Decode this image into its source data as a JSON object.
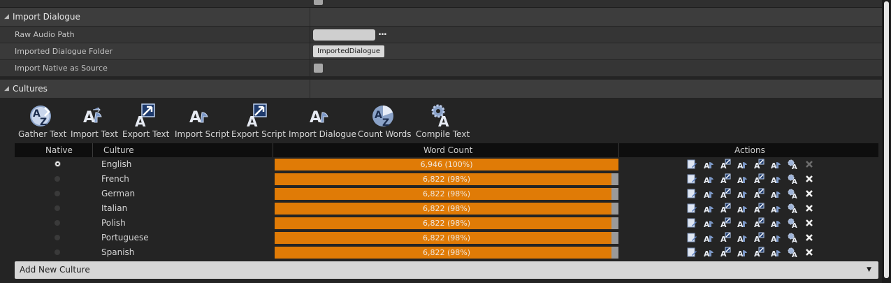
{
  "sections": {
    "import_dialogue": {
      "title": "Import Dialogue",
      "properties": [
        {
          "label": "Raw Audio Path",
          "value": "",
          "button": "..."
        },
        {
          "label": "Imported Dialogue Folder",
          "value": "ImportedDialogue"
        },
        {
          "label": "Import Native as Source",
          "checked": false
        }
      ]
    },
    "cultures": {
      "title": "Cultures"
    }
  },
  "toolbar": [
    {
      "label": "Gather Text",
      "icon": "gather-text-icon"
    },
    {
      "label": "Import Text",
      "icon": "import-text-icon"
    },
    {
      "label": "Export Text",
      "icon": "export-text-icon"
    },
    {
      "label": "Import Script",
      "icon": "import-script-icon"
    },
    {
      "label": "Export Script",
      "icon": "export-script-icon"
    },
    {
      "label": "Import Dialogue",
      "icon": "import-dialogue-icon"
    },
    {
      "label": "Count Words",
      "icon": "count-words-icon"
    },
    {
      "label": "Compile Text",
      "icon": "compile-text-icon"
    }
  ],
  "table": {
    "headers": {
      "native": "Native",
      "culture": "Culture",
      "word_count": "Word Count",
      "actions": "Actions"
    },
    "rows": [
      {
        "native": true,
        "culture": "English",
        "word_count": "6,946 (100%)",
        "percent": 100
      },
      {
        "native": false,
        "culture": "French",
        "word_count": "6,822 (98%)",
        "percent": 98
      },
      {
        "native": false,
        "culture": "German",
        "word_count": "6,822 (98%)",
        "percent": 98
      },
      {
        "native": false,
        "culture": "Italian",
        "word_count": "6,822 (98%)",
        "percent": 98
      },
      {
        "native": false,
        "culture": "Polish",
        "word_count": "6,822 (98%)",
        "percent": 98
      },
      {
        "native": false,
        "culture": "Portuguese",
        "word_count": "6,822 (98%)",
        "percent": 98
      },
      {
        "native": false,
        "culture": "Spanish",
        "word_count": "6,822 (98%)",
        "percent": 98
      }
    ]
  },
  "add_culture": {
    "label": "Add New Culture"
  },
  "colors": {
    "accent": "#e07b06",
    "bar_bg": "#9a9a9a"
  }
}
